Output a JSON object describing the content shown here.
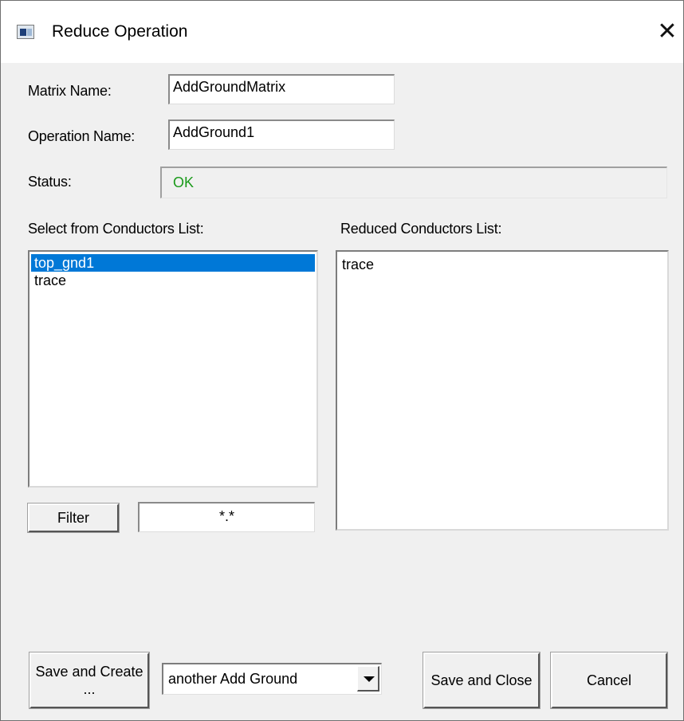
{
  "window": {
    "title": "Reduce Operation",
    "close_glyph": "✕",
    "icon": "app-window-icon"
  },
  "form": {
    "matrix_name_label": "Matrix Name:",
    "matrix_name_value": "AddGroundMatrix",
    "operation_name_label": "Operation Name:",
    "operation_name_value": "AddGround1",
    "status_label": "Status:",
    "status_value": "OK",
    "status_color": "#1a9a1a"
  },
  "conductors": {
    "select_label": "Select from Conductors List:",
    "select_items": [
      {
        "label": "top_gnd1",
        "selected": true
      },
      {
        "label": "trace",
        "selected": false
      }
    ],
    "reduced_label": "Reduced Conductors List:",
    "reduced_items": [
      {
        "label": "trace"
      }
    ]
  },
  "filter": {
    "button_label": "Filter",
    "value": "*.*"
  },
  "footer": {
    "save_create_label": "Save and Create ...",
    "combo_value": "another Add Ground",
    "save_close_label": "Save and Close",
    "cancel_label": "Cancel"
  },
  "colors": {
    "selection": "#0078d7",
    "background": "#f0f0f0"
  }
}
